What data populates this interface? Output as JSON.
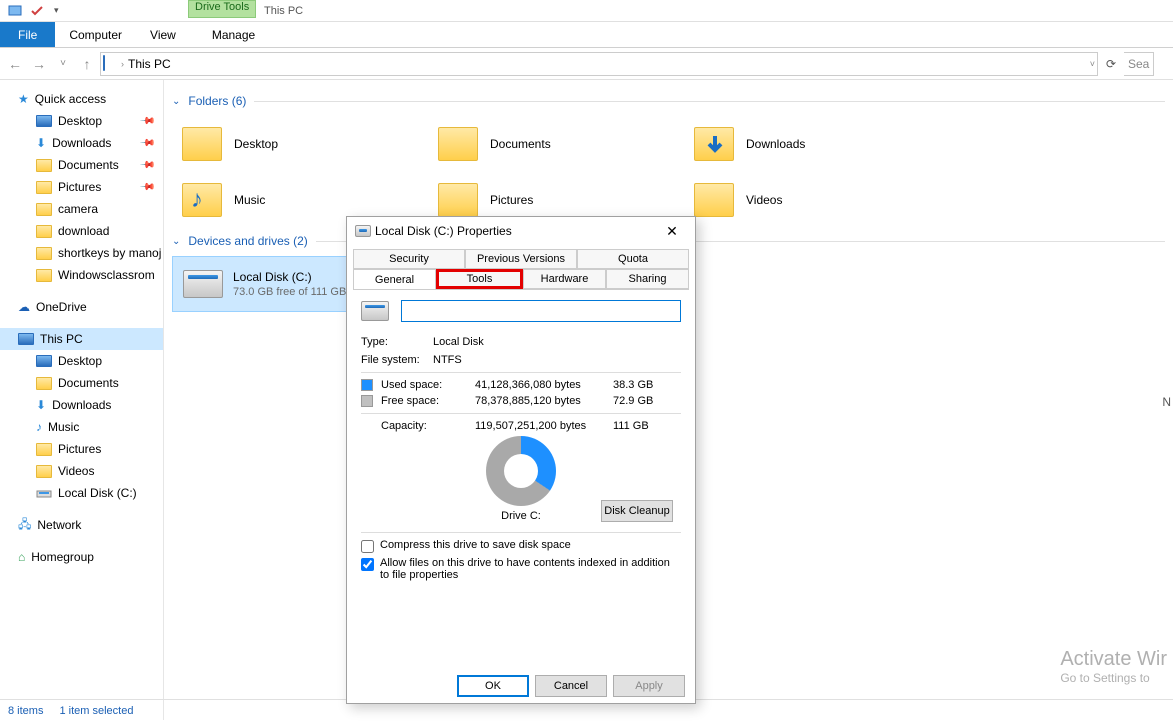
{
  "qat": {
    "dropdown": "▾"
  },
  "ribbon": {
    "file": "File",
    "tabs": [
      "Computer",
      "View",
      "Manage"
    ],
    "contextual_group": "Drive Tools",
    "context_title": "This PC"
  },
  "nav": {
    "back": "←",
    "forward": "→",
    "recent": "˅",
    "up": "↑",
    "crumb_sep": "›",
    "location": "This PC",
    "dropdown": "˅",
    "refresh": "⟳",
    "search_placeholder": "Sea"
  },
  "sidebar": {
    "quick_access": "Quick access",
    "qa_items": [
      {
        "label": "Desktop",
        "pinned": true
      },
      {
        "label": "Downloads",
        "pinned": true
      },
      {
        "label": "Documents",
        "pinned": true
      },
      {
        "label": "Pictures",
        "pinned": true
      },
      {
        "label": "camera",
        "pinned": false
      },
      {
        "label": "download",
        "pinned": false
      },
      {
        "label": "shortkeys by manoj",
        "pinned": false
      },
      {
        "label": "Windowsclassrom",
        "pinned": false
      }
    ],
    "onedrive": "OneDrive",
    "thispc": "This PC",
    "pc_items": [
      "Desktop",
      "Documents",
      "Downloads",
      "Music",
      "Pictures",
      "Videos",
      "Local Disk (C:)"
    ],
    "network": "Network",
    "homegroup": "Homegroup"
  },
  "content": {
    "folders_header": "Folders (6)",
    "folders": [
      "Desktop",
      "Documents",
      "Downloads",
      "Music",
      "Pictures",
      "Videos"
    ],
    "drives_header": "Devices and drives (2)",
    "drive": {
      "name": "Local Disk (C:)",
      "sub": "73.0 GB free of 111 GB"
    }
  },
  "statusbar": {
    "left": "8 items",
    "right": "1 item selected",
    "right_letter": "N"
  },
  "watermark": {
    "title": "Activate Wir",
    "sub": "Go to Settings to"
  },
  "dialog": {
    "title": "Local Disk (C:) Properties",
    "close": "✕",
    "tabs_row1": [
      "Security",
      "Previous Versions",
      "Quota"
    ],
    "tabs_row2": [
      "General",
      "Tools",
      "Hardware",
      "Sharing"
    ],
    "active_tab": "General",
    "highlight_tab": "Tools",
    "volume_name": "",
    "type_label": "Type:",
    "type_value": "Local Disk",
    "fs_label": "File system:",
    "fs_value": "NTFS",
    "used_label": "Used space:",
    "used_bytes": "41,128,366,080 bytes",
    "used_hr": "38.3 GB",
    "free_label": "Free space:",
    "free_bytes": "78,378,885,120 bytes",
    "free_hr": "72.9 GB",
    "cap_label": "Capacity:",
    "cap_bytes": "119,507,251,200 bytes",
    "cap_hr": "111 GB",
    "drive_c_label": "Drive C:",
    "cleanup": "Disk Cleanup",
    "compress": "Compress this drive to save disk space",
    "index": "Allow files on this drive to have contents indexed in addition to file properties",
    "ok": "OK",
    "cancel": "Cancel",
    "apply": "Apply"
  }
}
